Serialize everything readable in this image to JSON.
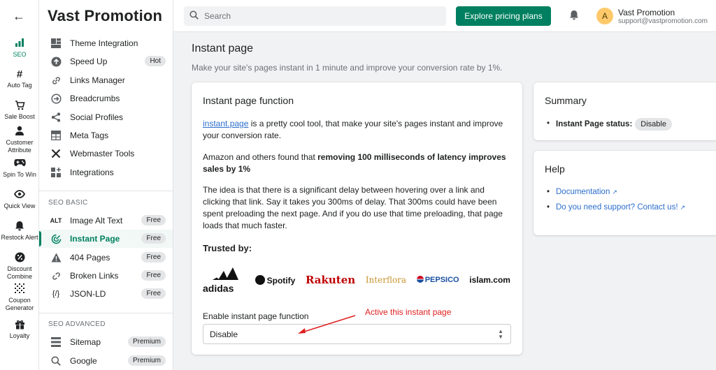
{
  "rail": {
    "back_icon": "arrow-left-icon",
    "items": [
      {
        "label": "SEO",
        "icon": "bar-chart-icon"
      },
      {
        "label": "Auto Tag",
        "icon": "hashtag-icon"
      },
      {
        "label": "Sale Boost",
        "icon": "cart-icon"
      },
      {
        "label": "Customer Attribute",
        "icon": "person-icon"
      },
      {
        "label": "Spin To Win",
        "icon": "gamepad-icon"
      },
      {
        "label": "Quick View",
        "icon": "eye-icon"
      },
      {
        "label": "Restock Alert",
        "icon": "bell-icon"
      },
      {
        "label": "Discount Combine",
        "icon": "percent-badge-icon"
      },
      {
        "label": "Coupon Generator",
        "icon": "qr-code-icon"
      },
      {
        "label": "Loyalty",
        "icon": "gift-icon"
      }
    ]
  },
  "sidebar": {
    "brand": "Vast Promotion",
    "items": [
      {
        "label": "Theme Integration",
        "icon": "layout-icon"
      },
      {
        "label": "Speed Up",
        "icon": "arrow-up-circle-icon",
        "badge": "Hot"
      },
      {
        "label": "Links Manager",
        "icon": "link-icon"
      },
      {
        "label": "Breadcrumbs",
        "icon": "arrow-right-circle-icon"
      },
      {
        "label": "Social Profiles",
        "icon": "share-icon"
      },
      {
        "label": "Meta Tags",
        "icon": "table-icon"
      },
      {
        "label": "Webmaster Tools",
        "icon": "tools-icon"
      },
      {
        "label": "Integrations",
        "icon": "apps-icon"
      }
    ],
    "basic_title": "SEO BASIC",
    "basic_items": [
      {
        "label": "Image Alt Text",
        "icon": "alt-text-icon",
        "badge": "Free"
      },
      {
        "label": "Instant Page",
        "icon": "radar-icon",
        "badge": "Free"
      },
      {
        "label": "404 Pages",
        "icon": "warning-icon",
        "badge": "Free"
      },
      {
        "label": "Broken Links",
        "icon": "broken-link-icon",
        "badge": "Free"
      },
      {
        "label": "JSON-LD",
        "icon": "code-icon",
        "badge": "Free"
      }
    ],
    "advanced_title": "SEO ADVANCED",
    "advanced_items": [
      {
        "label": "Sitemap",
        "icon": "list-icon",
        "badge": "Premium"
      },
      {
        "label": "Google",
        "icon": "search-icon",
        "badge": "Premium"
      }
    ]
  },
  "topbar": {
    "search_placeholder": "Search",
    "cta_label": "Explore pricing plans",
    "user_initial": "A",
    "user_name": "Vast Promotion",
    "user_email": "support@vastpromotion.com"
  },
  "main": {
    "title": "Instant page",
    "subtitle": "Make your site's pages instant in 1 minute and improve your conversion rate by 1%.",
    "card": {
      "title": "Instant page function",
      "p1_link": "instant.page",
      "p1_rest": " is a pretty cool tool, that make your site's pages instant and improve your conversion rate.",
      "p2_start": "Amazon and others found that ",
      "p2_bold": "removing 100 milliseconds of latency improves sales by 1%",
      "p3": "The idea is that there is a significant delay between hovering over a link and clicking that link. Say it takes you 300ms of delay. That 300ms could have been spent preloading the next page. And if you do use that time preloading, that page loads that much faster.",
      "trusted_title": "Trusted by:",
      "logos": [
        "adidas",
        "Spotify",
        "Rakuten",
        "Interflora",
        "PEPSICO",
        "islam.com"
      ],
      "field_label": "Enable instant page function",
      "select_value": "Disable",
      "annotation": "Active this instant page",
      "annotation_color": "#e02020"
    }
  },
  "summary": {
    "title": "Summary",
    "status_label": "Instant Page status:",
    "status_value": "Disable"
  },
  "help": {
    "title": "Help",
    "links": [
      "Documentation",
      "Do you need support? Contact us!"
    ]
  },
  "colors": {
    "accent": "#008060",
    "link": "#2c6ecb",
    "annotation": "#e02020"
  }
}
